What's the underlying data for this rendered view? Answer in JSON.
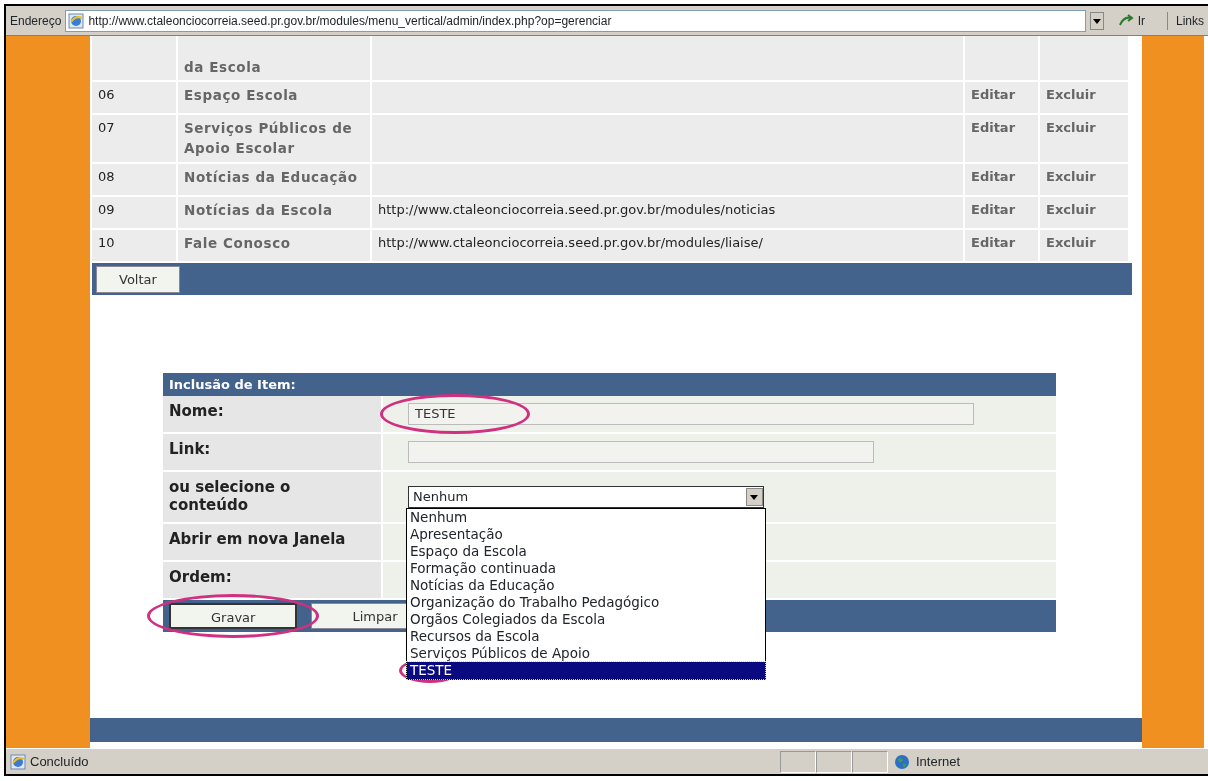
{
  "address_bar": {
    "label": "Endereço",
    "url": "http://www.ctaleonciocorreia.seed.pr.gov.br/modules/menu_vertical/admin/index.php?op=gerenciar",
    "go": "Ir",
    "links": "Links"
  },
  "table": {
    "rows": [
      {
        "name": "da Escola"
      },
      {
        "number": "06",
        "name": "Espaço Escola",
        "edit": "Editar",
        "delete": "Excluir"
      },
      {
        "number": "07",
        "name": "Serviços Públicos de Apoio Escolar",
        "edit": "Editar",
        "delete": "Excluir"
      },
      {
        "number": "08",
        "name": "Notícias da Educação",
        "edit": "Editar",
        "delete": "Excluir"
      },
      {
        "number": "09",
        "name": "Notícias da Escola",
        "link": "http://www.ctaleonciocorreia.seed.pr.gov.br/modules/noticias",
        "edit": "Editar",
        "delete": "Excluir"
      },
      {
        "number": "10",
        "name": "Fale Conosco",
        "link": "http://www.ctaleonciocorreia.seed.pr.gov.br/modules/liaise/",
        "edit": "Editar",
        "delete": "Excluir"
      }
    ],
    "back_button": "Voltar"
  },
  "form": {
    "title": "Inclusão de Item:",
    "fields": [
      {
        "kind": "text",
        "label": "Nome:",
        "value": "TESTE",
        "circled": true
      },
      {
        "kind": "text",
        "label": "Link:",
        "circled": false
      },
      {
        "kind": "select",
        "label": "ou selecione o conteúdo",
        "value": "Nenhum",
        "circled": false
      },
      {
        "kind": "hidden",
        "label": "Abrir em nova Janela",
        "circled": false
      },
      {
        "kind": "hidden",
        "label": "Ordem:",
        "circled": false
      }
    ],
    "buttons": [
      {
        "label": "Gravar",
        "circled": true
      },
      {
        "label": "Limpar",
        "circled": false
      }
    ],
    "dropdown": {
      "options": [
        {
          "label": "Nenhum",
          "selected": false,
          "circled": false
        },
        {
          "label": "Apresentação",
          "selected": false,
          "circled": false
        },
        {
          "label": "Espaço da Escola",
          "selected": false,
          "circled": false
        },
        {
          "label": "Formação continuada",
          "selected": false,
          "circled": false
        },
        {
          "label": "Notícias da Educação",
          "selected": false,
          "circled": false
        },
        {
          "label": "Organização do Trabalho Pedagógico",
          "selected": false,
          "circled": false
        },
        {
          "label": "Orgãos Colegiados da Escola",
          "selected": false,
          "circled": false
        },
        {
          "label": "Recursos da Escola",
          "selected": false,
          "circled": false
        },
        {
          "label": "Serviços Públicos de Apoio",
          "selected": false,
          "circled": false
        },
        {
          "label": "TESTE",
          "selected": true,
          "circled": true
        }
      ]
    }
  },
  "status_bar": {
    "text": "Concluído",
    "zone": "Internet"
  }
}
